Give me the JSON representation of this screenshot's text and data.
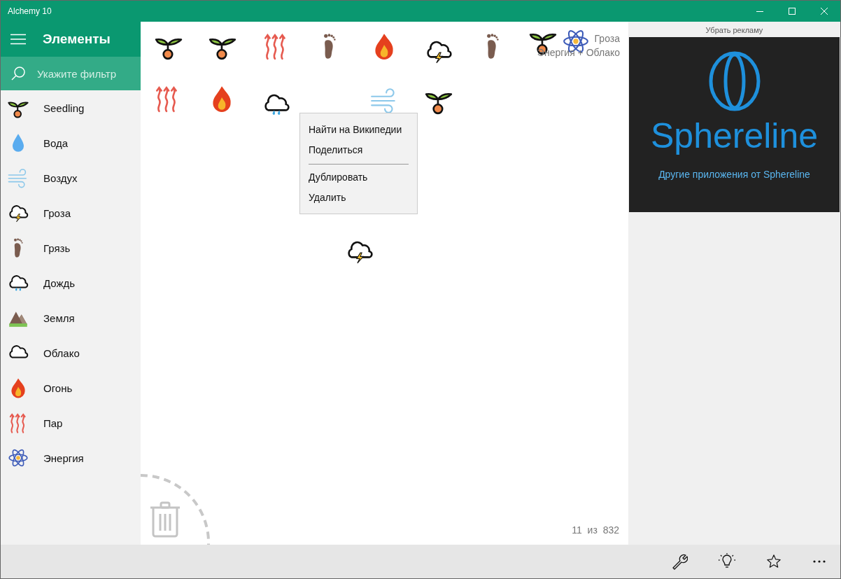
{
  "window": {
    "title": "Alchemy 10"
  },
  "sidebar": {
    "title": "Элементы",
    "filter": {
      "placeholder": "Укажите фильтр"
    },
    "items": [
      {
        "label": "Seedling",
        "kind": "seedling"
      },
      {
        "label": "Вода",
        "kind": "water"
      },
      {
        "label": "Воздух",
        "kind": "wind"
      },
      {
        "label": "Гроза",
        "kind": "storm"
      },
      {
        "label": "Грязь",
        "kind": "foot"
      },
      {
        "label": "Дождь",
        "kind": "rain"
      },
      {
        "label": "Земля",
        "kind": "earth"
      },
      {
        "label": "Облако",
        "kind": "cloud"
      },
      {
        "label": "Огонь",
        "kind": "fire"
      },
      {
        "label": "Пар",
        "kind": "steam"
      },
      {
        "label": "Энергия",
        "kind": "atom"
      }
    ]
  },
  "canvas": {
    "items": [
      {
        "kind": "seedling"
      },
      {
        "kind": "seedling"
      },
      {
        "kind": "steam"
      },
      {
        "kind": "foot"
      },
      {
        "kind": "fire"
      },
      {
        "kind": "storm"
      },
      {
        "kind": "foot"
      },
      {
        "kind": "seedling"
      },
      {
        "kind": "atom"
      },
      {
        "kind": "steam"
      },
      {
        "kind": "fire"
      },
      {
        "kind": "rain"
      },
      {
        "kind": "wind"
      },
      {
        "kind": "seedling"
      },
      {
        "kind": "storm"
      }
    ],
    "hint": {
      "result": "Гроза",
      "formula": "Энергия + Облако"
    },
    "counter": "11  из  832"
  },
  "context_menu": {
    "groups": [
      [
        "Найти на Википедии",
        "Поделиться"
      ],
      [
        "Дублировать",
        "Удалить"
      ]
    ]
  },
  "ad_panel": {
    "remove_ads": "Убрать рекламу",
    "brand": "Sphereline",
    "link": "Другие приложения от Sphereline"
  }
}
